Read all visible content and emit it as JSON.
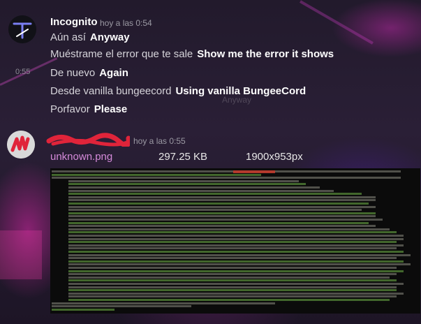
{
  "colors": {
    "accent_link": "#d48ad9",
    "username": "#ffffff",
    "timestamp": "#9b99a3",
    "redaction": "#e0243a"
  },
  "group1": {
    "avatar_icon": "incognito-avatar-icon",
    "username": "Incognito",
    "timestamp": "hoy a las 0:54",
    "hover_time": "0:55",
    "messages": [
      {
        "original": "Aún así",
        "translation": "Anyway"
      },
      {
        "original": "Muéstrame el error que te sale",
        "translation": "Show me the error it shows"
      },
      {
        "original": "De nuevo",
        "translation": "Again"
      },
      {
        "original": "Desde vanilla bungeecord",
        "translation": "Using vanilla BungeeCord"
      },
      {
        "original": "Porfavor",
        "translation": "Please"
      }
    ],
    "ghost_text": "Anyway"
  },
  "group2": {
    "avatar_icon": "redacted-avatar-icon",
    "timestamp": "hoy a las 0:55",
    "attachment": {
      "name": "unknown.png",
      "size": "297.25 KB",
      "dimensions": "1900x953px"
    }
  }
}
